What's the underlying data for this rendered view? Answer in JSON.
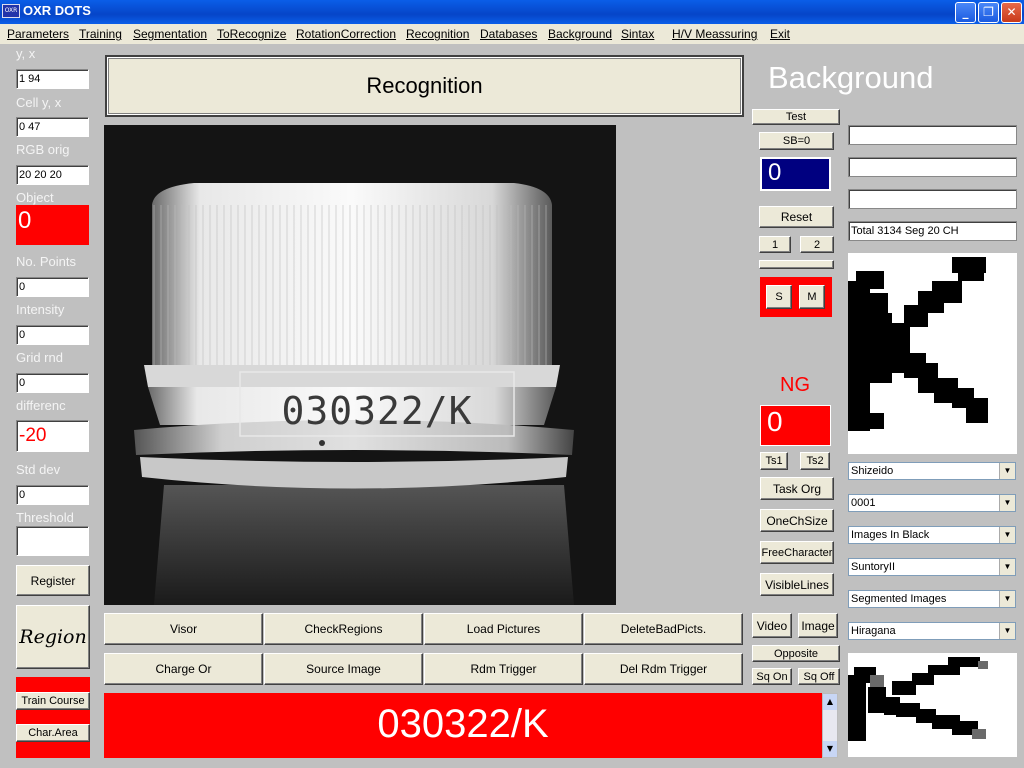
{
  "window": {
    "title": "OXR DOTS",
    "icon_text": "OXR"
  },
  "menu": [
    "Parameters",
    "Training",
    "Segmentation",
    "ToRecognize",
    "RotationCorrection",
    "Recognition",
    "Databases",
    "Background",
    "Sintax",
    "H/V Meassuring",
    "Exit"
  ],
  "left_panel": {
    "yx_label": "y, x",
    "yx_value": "1 94",
    "cell_label": "Cell y, x",
    "cell_value": "0 47",
    "rgb_label": "RGB orig",
    "rgb_value": "20 20 20",
    "object_label": "Object",
    "object_value": "0",
    "points_label": "No. Points",
    "points_value": "0",
    "intensity_label": "Intensity",
    "intensity_value": "0",
    "grid_label": "Grid rnd",
    "grid_value": "0",
    "diff_label": "differenc",
    "diff_value": "-20",
    "std_label": "Std dev",
    "std_value": "0",
    "threshold_label": "Threshold",
    "threshold_value": "",
    "register_label": "Register",
    "region_label": "Region",
    "train_course_label": "Train Course",
    "char_area_label": "Char.Area"
  },
  "header": {
    "recognition_title": "Recognition",
    "background_title": "Background"
  },
  "image": {
    "printed_code": "030322/K"
  },
  "bottom_buttons": {
    "row1": [
      "Visor",
      "CheckRegions",
      "Load Pictures",
      "DeleteBadPicts."
    ],
    "row2": [
      "Charge Or",
      "Source Image",
      "Rdm Trigger",
      "Del Rdm Trigger"
    ]
  },
  "result": {
    "text": "030322/K"
  },
  "mid_panel": {
    "test_label": "Test",
    "sb_label": "SB=0",
    "counter_value": "0",
    "reset_label": "Reset",
    "btn1": "1",
    "btn2": "2",
    "s_label": "S",
    "m_label": "M",
    "ng_label": "NG",
    "ng_value": "0",
    "ts1": "Ts1",
    "ts2": "Ts2",
    "task_org": "Task Org",
    "one_ch_size": "OneChSize",
    "free_character": "FreeCharacter",
    "visible_lines": "VisibleLines",
    "video": "Video",
    "image_btn": "Image",
    "opposite": "Opposite",
    "sq_on": "Sq On",
    "sq_off": "Sq Off"
  },
  "right_panel": {
    "field1": "",
    "field2": "",
    "field3": "",
    "total_text": "Total 3134  Seg 20  CH",
    "combo1": "Shizeido",
    "combo2": "0001",
    "combo3": "Images In Black",
    "combo4": "SuntoryII",
    "combo5": "Segmented Images",
    "combo6": "Hiragana"
  },
  "colors": {
    "accent_red": "#ff0000",
    "counter_blue": "#000080",
    "panel_gray": "#c0c0c0",
    "title_blue": "#0a5ee8"
  }
}
